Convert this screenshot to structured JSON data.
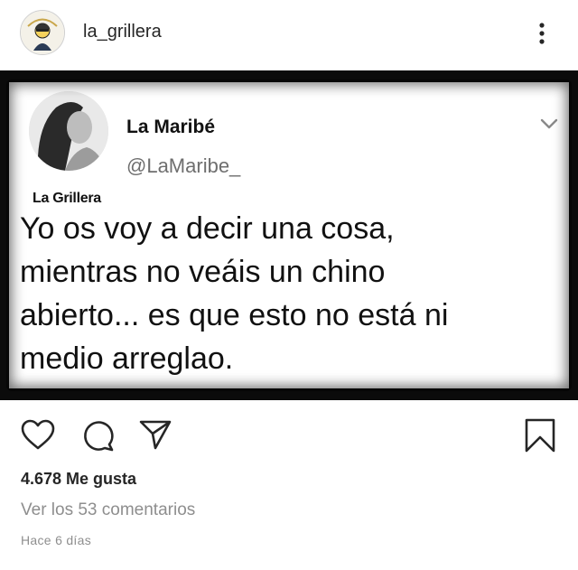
{
  "header": {
    "username": "la_grillera",
    "avatar_icon": "cartoon-avatar-icon",
    "more_icon": "more-vertical-icon"
  },
  "tweet": {
    "display_name": "La Maribé",
    "handle": "@LaMaribe_",
    "brand_watermark": "La Grillera",
    "text_lines": [
      "Yo os voy a decir una cosa,",
      "mientras no veáis un chino",
      "abierto... es que esto no está ni",
      "medio arreglao."
    ],
    "chevron_icon": "chevron-down-icon"
  },
  "actions": {
    "like_icon": "heart-icon",
    "comment_icon": "comment-icon",
    "share_icon": "paper-plane-icon",
    "save_icon": "bookmark-icon"
  },
  "likes_text": "4.678 Me gusta",
  "comments_link": "Ver los 53 comentarios",
  "timestamp": "Hace 6 días",
  "colors": {
    "text": "#262626",
    "secondary": "#8e8e8e",
    "frame": "#0b0b0b"
  }
}
